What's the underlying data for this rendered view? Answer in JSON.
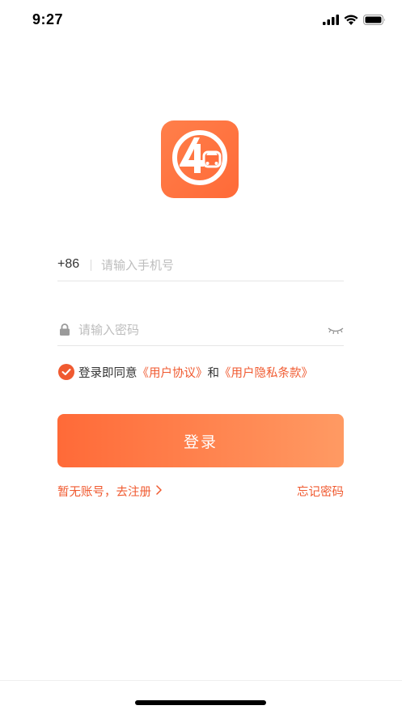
{
  "status_bar": {
    "time": "9:27",
    "icons": [
      "signal-icon",
      "wifi-icon",
      "battery-icon"
    ]
  },
  "logo": {
    "icon": "app-logo-icon",
    "color": "#ff6e3c"
  },
  "phone": {
    "country_code": "+86",
    "placeholder": "请输入手机号",
    "value": ""
  },
  "password": {
    "placeholder": "请输入密码",
    "value": "",
    "lock_icon": "lock-icon",
    "visibility_icon": "eye-closed-icon"
  },
  "agreement": {
    "checked": true,
    "prefix": "登录即同意",
    "user_agreement": "《用户协议》",
    "and": "和",
    "privacy_policy": "《用户隐私条款》"
  },
  "login_button": {
    "label": "登录"
  },
  "links": {
    "register": "暂无账号，去注册",
    "register_icon": "chevron-right-icon",
    "forgot_password": "忘记密码"
  },
  "colors": {
    "accent": "#f05a30",
    "button_gradient_start": "#ff6a38",
    "button_gradient_end": "#ff9a63"
  }
}
